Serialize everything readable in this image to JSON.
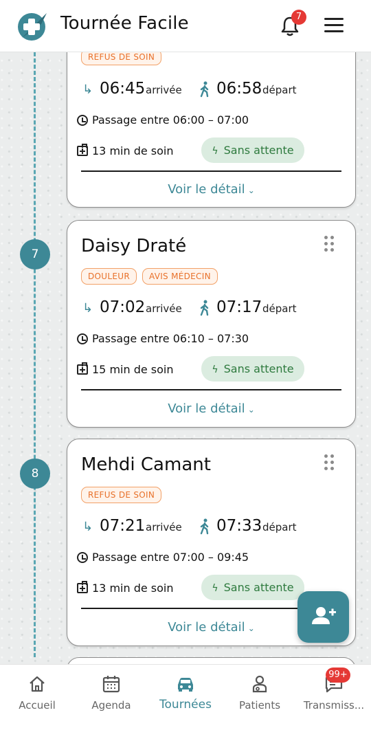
{
  "app": {
    "title": "Tournée Facile",
    "notification_count": "7"
  },
  "colors": {
    "accent": "#3d8896",
    "tag_orange": "#e8712a",
    "pill_green": "#2e7a3e",
    "badge_red": "#e53935"
  },
  "visits": [
    {
      "name": "",
      "tags": [
        "REFUS DE SOIN"
      ],
      "arrival": "06:45",
      "arrival_label": "arrivée",
      "departure": "06:58",
      "departure_label": "départ",
      "window": "Passage entre 06:00 – 07:00",
      "care": "13 min de soin",
      "wait": "Sans attente",
      "detail_label": "Voir le détail"
    },
    {
      "step": "7",
      "name": "Daisy Draté",
      "tags": [
        "DOULEUR",
        "AVIS MÉDECIN"
      ],
      "arrival": "07:02",
      "arrival_label": "arrivée",
      "departure": "07:17",
      "departure_label": "départ",
      "window": "Passage entre 06:10 – 07:30",
      "care": "15 min de soin",
      "wait": "Sans attente",
      "detail_label": "Voir le détail"
    },
    {
      "step": "8",
      "name": "Mehdi Camant",
      "tags": [
        "REFUS DE SOIN"
      ],
      "arrival": "07:21",
      "arrival_label": "arrivée",
      "departure": "07:33",
      "departure_label": "départ",
      "window": "Passage entre 07:00 – 09:45",
      "care": "13 min de soin",
      "wait": "Sans attente",
      "detail_label": "Voir le détail"
    }
  ],
  "nav": {
    "items": [
      {
        "label": "Accueil",
        "icon": "home-icon"
      },
      {
        "label": "Agenda",
        "icon": "calendar-icon"
      },
      {
        "label": "Tournées",
        "icon": "car-icon",
        "active": true
      },
      {
        "label": "Patients",
        "icon": "patient-icon"
      },
      {
        "label": "Transmiss...",
        "icon": "chat-icon"
      }
    ],
    "transmissions_badge": "99+"
  }
}
